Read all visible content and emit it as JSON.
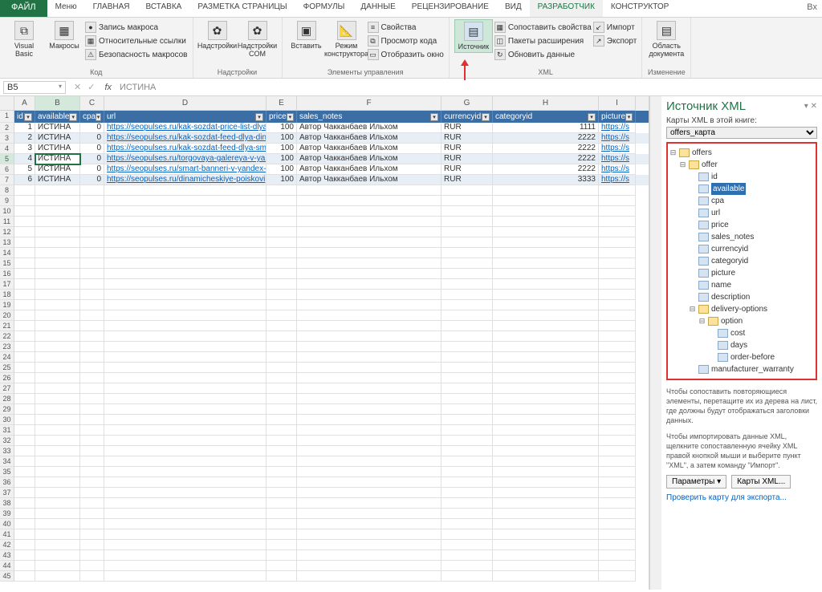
{
  "tabs": {
    "file": "ФАЙЛ",
    "items": [
      "Меню",
      "ГЛАВНАЯ",
      "ВСТАВКА",
      "РАЗМЕТКА СТРАНИЦЫ",
      "ФОРМУЛЫ",
      "ДАННЫЕ",
      "РЕЦЕНЗИРОВАНИЕ",
      "ВИД",
      "РАЗРАБОТЧИК",
      "КОНСТРУКТОР"
    ],
    "active": 8,
    "account": "Вх"
  },
  "ribbon": {
    "code": {
      "vb": "Visual\nBasic",
      "mac": "Макросы",
      "rec": "Запись макроса",
      "rel": "Относительные ссылки",
      "sec": "Безопасность макросов",
      "label": "Код"
    },
    "addins": {
      "add": "Надстройки",
      "com": "Надстройки\nCOM",
      "label": "Надстройки"
    },
    "controls": {
      "ins": "Вставить",
      "mode": "Режим\nконструктора",
      "prop": "Свойства",
      "view": "Просмотр кода",
      "win": "Отобразить окно",
      "label": "Элементы управления"
    },
    "xml": {
      "src": "Источник",
      "map": "Сопоставить свойства",
      "ext": "Пакеты расширения",
      "upd": "Обновить данные",
      "imp": "Импорт",
      "exp": "Экспорт",
      "label": "XML"
    },
    "doc": {
      "area": "Область\nдокумента",
      "label": "Изменение"
    }
  },
  "formula": {
    "name": "B5",
    "value": "ИСТИНА"
  },
  "columns": [
    "A",
    "B",
    "C",
    "D",
    "E",
    "F",
    "G",
    "H",
    "I"
  ],
  "active_col": 1,
  "active_row": 5,
  "headers": [
    "id",
    "available",
    "cpa",
    "url",
    "price",
    "sales_notes",
    "currencyid",
    "categoryid",
    "picture"
  ],
  "rows": [
    {
      "n": 1,
      "data": [
        "1",
        "ИСТИНА",
        "0",
        "https://seopulses.ru/kak-sozdat-price-list-dlya",
        "100",
        "Автор Чакканбаев Ильхом",
        "RUR",
        "1111",
        "https://s"
      ]
    },
    {
      "n": 2,
      "data": [
        "2",
        "ИСТИНА",
        "0",
        "https://seopulses.ru/kak-sozdat-feed-dlya-din",
        "100",
        "Автор Чакканбаев Ильхом",
        "RUR",
        "2222",
        "https://s"
      ]
    },
    {
      "n": 3,
      "data": [
        "3",
        "ИСТИНА",
        "0",
        "https://seopulses.ru/kak-sozdat-feed-dlya-sm",
        "100",
        "Автор Чакканбаев Ильхом",
        "RUR",
        "2222",
        "https://s"
      ]
    },
    {
      "n": 4,
      "data": [
        "4",
        "ИСТИНА",
        "0",
        "https://seopulses.ru/torgovaya-galereya-v-yan",
        "100",
        "Автор Чакканбаев Ильхом",
        "RUR",
        "2222",
        "https://s"
      ]
    },
    {
      "n": 5,
      "data": [
        "5",
        "ИСТИНА",
        "0",
        "https://seopulses.ru/smart-banneri-v-yandex-d",
        "100",
        "Автор Чакканбаев Ильхом",
        "RUR",
        "2222",
        "https://s"
      ]
    },
    {
      "n": 6,
      "data": [
        "6",
        "ИСТИНА",
        "0",
        "https://seopulses.ru/dinamicheskiye-poiskovi",
        "100",
        "Автор Чакканбаев Ильхом",
        "RUR",
        "3333",
        "https://s"
      ]
    }
  ],
  "empty_rows": [
    8,
    9,
    10,
    11,
    12,
    13,
    14,
    15,
    16,
    17,
    18,
    19,
    20,
    21,
    22,
    23,
    24,
    25,
    26,
    27,
    28,
    29,
    30,
    31,
    32,
    33,
    34,
    35,
    36,
    37,
    38,
    39,
    40,
    41,
    42,
    43,
    44,
    45
  ],
  "xml": {
    "title": "Источник XML",
    "sub": "Карты XML в этой книге:",
    "map": "offers_карта",
    "tree": [
      {
        "ind": 0,
        "exp": "⊟",
        "t": "f",
        "lbl": "offers"
      },
      {
        "ind": 1,
        "exp": "⊟",
        "t": "f",
        "lbl": "offer"
      },
      {
        "ind": 2,
        "exp": "",
        "t": "e",
        "lbl": "id"
      },
      {
        "ind": 2,
        "exp": "",
        "t": "e",
        "lbl": "available",
        "sel": true
      },
      {
        "ind": 2,
        "exp": "",
        "t": "e",
        "lbl": "cpa"
      },
      {
        "ind": 2,
        "exp": "",
        "t": "e",
        "lbl": "url"
      },
      {
        "ind": 2,
        "exp": "",
        "t": "e",
        "lbl": "price"
      },
      {
        "ind": 2,
        "exp": "",
        "t": "e",
        "lbl": "sales_notes"
      },
      {
        "ind": 2,
        "exp": "",
        "t": "e",
        "lbl": "currencyid"
      },
      {
        "ind": 2,
        "exp": "",
        "t": "e",
        "lbl": "categoryid"
      },
      {
        "ind": 2,
        "exp": "",
        "t": "e",
        "lbl": "picture"
      },
      {
        "ind": 2,
        "exp": "",
        "t": "e",
        "lbl": "name"
      },
      {
        "ind": 2,
        "exp": "",
        "t": "e",
        "lbl": "description"
      },
      {
        "ind": 2,
        "exp": "⊟",
        "t": "f",
        "lbl": "delivery-options"
      },
      {
        "ind": 3,
        "exp": "⊟",
        "t": "f",
        "lbl": "option"
      },
      {
        "ind": 4,
        "exp": "",
        "t": "e",
        "lbl": "cost"
      },
      {
        "ind": 4,
        "exp": "",
        "t": "e",
        "lbl": "days"
      },
      {
        "ind": 4,
        "exp": "",
        "t": "e",
        "lbl": "order-before"
      },
      {
        "ind": 2,
        "exp": "",
        "t": "e",
        "lbl": "manufacturer_warranty"
      }
    ],
    "hint1": "Чтобы сопоставить повторяющиеся элементы, перетащите их из дерева на лист, где должны будут отображаться заголовки данных.",
    "hint2": "Чтобы импортировать данные XML, щелкните сопоставленную ячейку XML правой кнопкой мыши и выберите пункт \"XML\", а затем команду \"Импорт\".",
    "params": "Параметры ▾",
    "maps": "Карты XML...",
    "verify": "Проверить карту для экспорта..."
  }
}
